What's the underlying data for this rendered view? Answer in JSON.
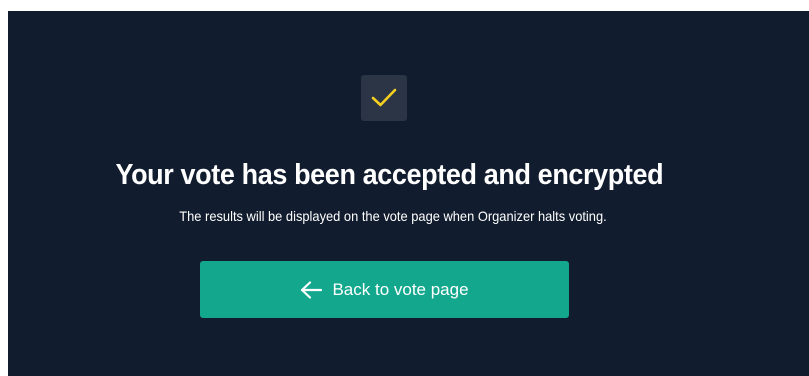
{
  "confirmation": {
    "icon": "checkmark-icon",
    "accent_color": "#f5d020",
    "title": "Your vote has been accepted and encrypted",
    "message": "The results will be displayed on the vote page when Organizer halts voting."
  },
  "back_button": {
    "icon": "arrow-left-icon",
    "label": "Back to vote page",
    "color": "#13a78e"
  },
  "panel_color": "#111c2e"
}
